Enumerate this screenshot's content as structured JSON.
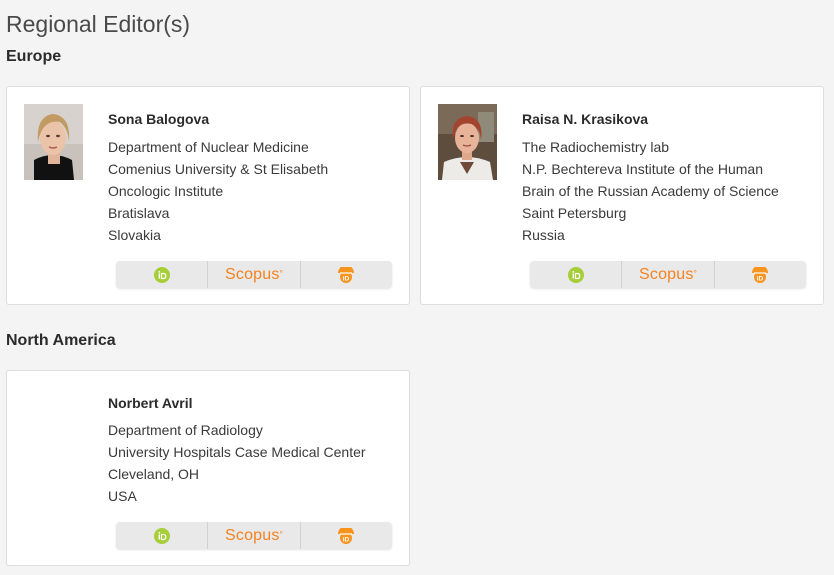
{
  "page": {
    "title": "Regional Editor(s)"
  },
  "regions": [
    {
      "name": "Europe",
      "editors": [
        {
          "name": "Sona Balogova",
          "affiliation": [
            "Department of Nuclear Medicine",
            "Comenius University & St Elisabeth",
            "Oncologic Institute",
            "Bratislava",
            "Slovakia"
          ],
          "has_photo": true,
          "photo_kind": "woman-blonde"
        },
        {
          "name": "Raisa N. Krasikova",
          "affiliation": [
            "The Radiochemistry lab",
            "N.P. Bechtereva Institute of the Human",
            "Brain of the Russian Academy of Science",
            "Saint Petersburg",
            "Russia"
          ],
          "has_photo": true,
          "photo_kind": "woman-red-hair"
        }
      ]
    },
    {
      "name": "North America",
      "editors": [
        {
          "name": "Norbert Avril",
          "affiliation": [
            "Department of Radiology",
            "University Hospitals Case Medical Center",
            "Cleveland, OH",
            "USA"
          ],
          "has_photo": false
        }
      ]
    }
  ],
  "links": {
    "orcid_icon": "orcid-icon",
    "scopus_label": "Scopus",
    "publications_icon": "publications-icon"
  },
  "colors": {
    "orcid_green": "#a6ce39",
    "scopus_orange": "#f58220",
    "pubs_orange": "#f7941d"
  }
}
